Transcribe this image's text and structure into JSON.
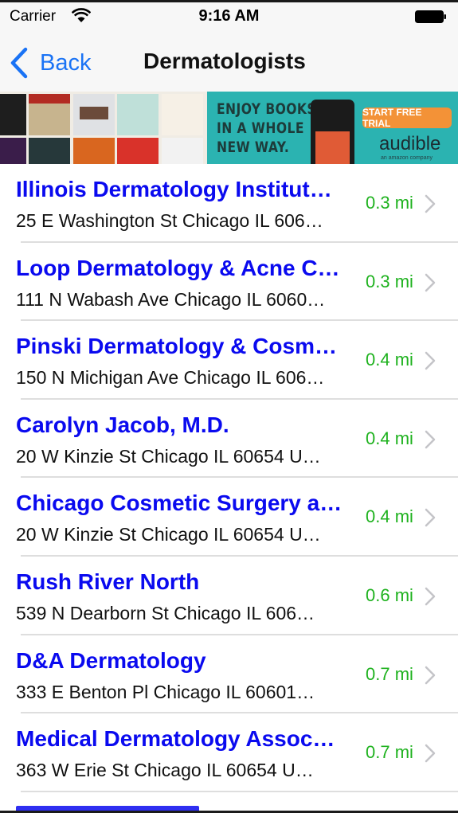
{
  "status_bar": {
    "carrier": "Carrier",
    "time": "9:16 AM",
    "battery_level": 1.0
  },
  "nav": {
    "back_label": "Back",
    "title": "Dermatologists"
  },
  "ad": {
    "headline_line1": "ENJOY BOOKS",
    "headline_line2": "IN A WHOLE",
    "headline_line3": "NEW WAY.",
    "cta_label": "START FREE TRIAL",
    "brand": "audible",
    "brand_sub": "an amazon company",
    "background_color": "#2bb3b1",
    "cta_color": "#f39237"
  },
  "colors": {
    "link_blue": "#1a73f5",
    "name_blue": "#0a0aef",
    "distance_green": "#1fb21f",
    "chevron_gray": "#c4c4c8"
  },
  "results": [
    {
      "name": "Illinois Dermatology Institut…",
      "address": "25 E Washington St Chicago IL 606…",
      "distance": "0.3 mi"
    },
    {
      "name": "Loop Dermatology & Acne C…",
      "address": "111 N Wabash Ave Chicago IL 6060…",
      "distance": "0.3 mi"
    },
    {
      "name": "Pinski Dermatology & Cosm…",
      "address": "150 N Michigan Ave Chicago IL 606…",
      "distance": "0.4 mi"
    },
    {
      "name": "Carolyn Jacob, M.D.",
      "address": "20 W Kinzie St Chicago IL 60654 U…",
      "distance": "0.4 mi"
    },
    {
      "name": "Chicago Cosmetic Surgery a…",
      "address": "20 W Kinzie St Chicago IL 60654 U…",
      "distance": "0.4 mi"
    },
    {
      "name": "Rush River North",
      "address": "539 N Dearborn St Chicago IL 606…",
      "distance": "0.6 mi"
    },
    {
      "name": "D&A Dermatology",
      "address": "333 E Benton Pl Chicago IL 60601…",
      "distance": "0.7 mi"
    },
    {
      "name": "Medical Dermatology Assoc…",
      "address": "363 W Erie St Chicago IL 60654 U…",
      "distance": "0.7 mi"
    }
  ]
}
